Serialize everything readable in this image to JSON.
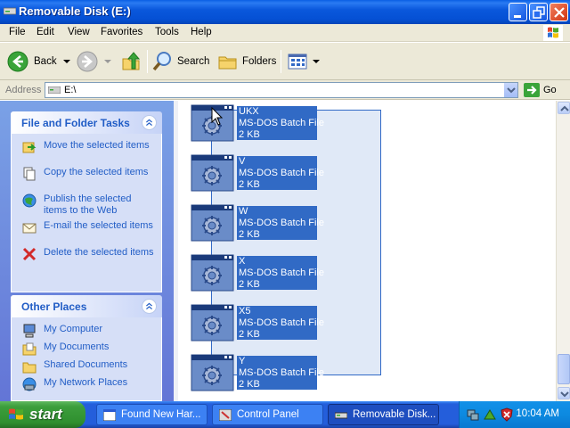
{
  "window": {
    "title": "Removable Disk (E:)"
  },
  "menu": [
    "File",
    "Edit",
    "View",
    "Favorites",
    "Tools",
    "Help"
  ],
  "toolbar": {
    "back": "Back",
    "search": "Search",
    "folders": "Folders"
  },
  "address": {
    "label": "Address",
    "value": "E:\\",
    "go": "Go"
  },
  "sidebar": {
    "file_tasks": {
      "title": "File and Folder Tasks",
      "items": [
        {
          "label": "Move the selected items",
          "icon": "move-icon"
        },
        {
          "label": "Copy the selected items",
          "icon": "copy-icon"
        },
        {
          "label": "Publish the selected items to the Web",
          "icon": "publish-web-icon"
        },
        {
          "label": "E-mail the selected items",
          "icon": "email-icon"
        },
        {
          "label": "Delete the selected items",
          "icon": "delete-icon"
        }
      ]
    },
    "other_places": {
      "title": "Other Places",
      "items": [
        {
          "label": "My Computer",
          "icon": "my-computer-icon"
        },
        {
          "label": "My Documents",
          "icon": "my-documents-icon"
        },
        {
          "label": "Shared Documents",
          "icon": "shared-documents-icon"
        },
        {
          "label": "My Network Places",
          "icon": "network-places-icon"
        }
      ]
    }
  },
  "files": [
    {
      "name": "UKX",
      "type": "MS-DOS Batch File",
      "size": "2 KB"
    },
    {
      "name": "V",
      "type": "MS-DOS Batch File",
      "size": "2 KB"
    },
    {
      "name": "W",
      "type": "MS-DOS Batch File",
      "size": "2 KB"
    },
    {
      "name": "X",
      "type": "MS-DOS Batch File",
      "size": "2 KB"
    },
    {
      "name": "X5",
      "type": "MS-DOS Batch File",
      "size": "2 KB"
    },
    {
      "name": "Y",
      "type": "MS-DOS Batch File",
      "size": "2 KB"
    }
  ],
  "taskbar": {
    "start": "start",
    "buttons": [
      {
        "label": "Found New Har...",
        "active": false
      },
      {
        "label": "Control Panel",
        "active": false
      },
      {
        "label": "Removable Disk...",
        "active": true
      }
    ],
    "clock": "10:04 AM"
  },
  "colors": {
    "selection": "#316ac5",
    "titlebar": "#0a58dc",
    "taskbar": "#245edb",
    "start": "#3c9e3c"
  }
}
